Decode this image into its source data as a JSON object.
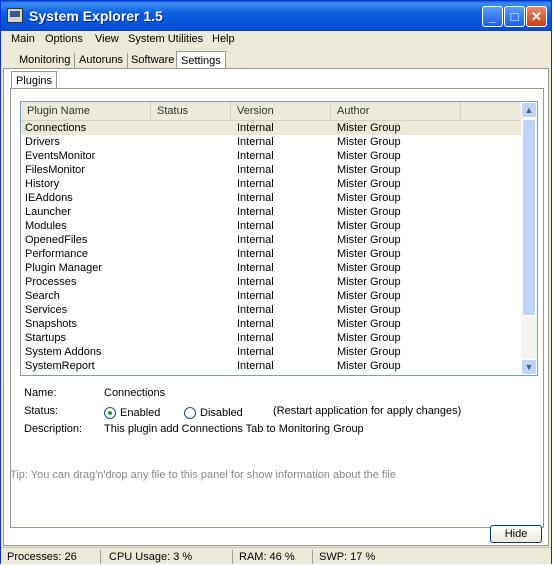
{
  "window": {
    "title": "System Explorer 1.5",
    "controls": [
      "_",
      "□",
      "✕"
    ]
  },
  "menu": [
    "Main",
    "Options",
    "View",
    "System Utilities",
    "Help"
  ],
  "tabs": [
    "Monitoring",
    "Autoruns",
    "Software",
    "Settings"
  ],
  "active_tab": "Settings",
  "subtab": "Plugins",
  "table": {
    "columns": [
      "Plugin Name",
      "Status",
      "Version",
      "Author"
    ],
    "rows": [
      [
        "Connections",
        "",
        "Internal",
        "Mister Group"
      ],
      [
        "Drivers",
        "",
        "Internal",
        "Mister Group"
      ],
      [
        "EventsMonitor",
        "",
        "Internal",
        "Mister Group"
      ],
      [
        "FilesMonitor",
        "",
        "Internal",
        "Mister Group"
      ],
      [
        "History",
        "",
        "Internal",
        "Mister Group"
      ],
      [
        "IEAddons",
        "",
        "Internal",
        "Mister Group"
      ],
      [
        "Launcher",
        "",
        "Internal",
        "Mister Group"
      ],
      [
        "Modules",
        "",
        "Internal",
        "Mister Group"
      ],
      [
        "OpenedFiles",
        "",
        "Internal",
        "Mister Group"
      ],
      [
        "Performance",
        "",
        "Internal",
        "Mister Group"
      ],
      [
        "Plugin Manager",
        "",
        "Internal",
        "Mister Group"
      ],
      [
        "Processes",
        "",
        "Internal",
        "Mister Group"
      ],
      [
        "Search",
        "",
        "Internal",
        "Mister Group"
      ],
      [
        "Services",
        "",
        "Internal",
        "Mister Group"
      ],
      [
        "Snapshots",
        "",
        "Internal",
        "Mister Group"
      ],
      [
        "Startups",
        "",
        "Internal",
        "Mister Group"
      ],
      [
        "System Addons",
        "",
        "Internal",
        "Mister Group"
      ],
      [
        "SystemReport",
        "",
        "Internal",
        "Mister Group"
      ]
    ],
    "selected": "Connections"
  },
  "details": {
    "name_label": "Name:",
    "name_value": "Connections",
    "status_label": "Status:",
    "enabled_label": "Enabled",
    "disabled_label": "Disabled",
    "enabled_checked": true,
    "restart_note": "(Restart application for apply changes)",
    "description_label": "Description:",
    "description_value": "This plugin add Connections Tab to Monitoring Group"
  },
  "tip": "Tip: You can drag'n'drop any file to this panel for show information about the file",
  "hide_button": "Hide",
  "status": {
    "processes": "Processes: 26",
    "cpu": "CPU Usage: 3 %",
    "ram": "RAM: 46 %",
    "swp": "SWP: 17 %"
  }
}
